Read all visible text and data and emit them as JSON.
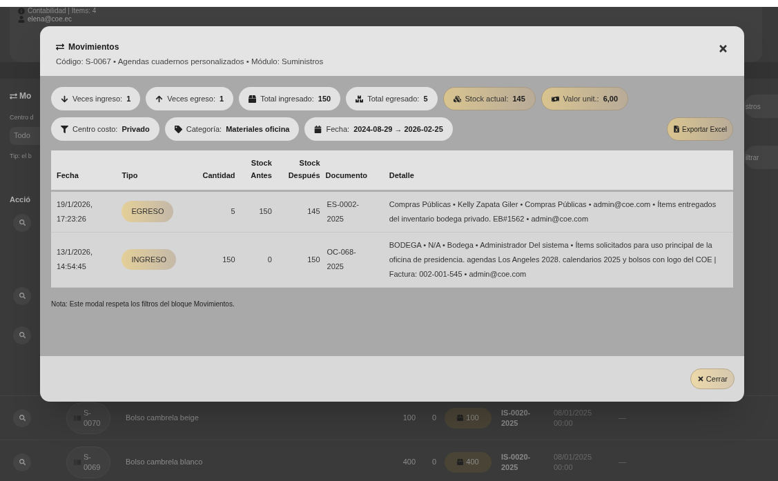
{
  "background": {
    "account": {
      "area": "Contabilidad | Items: 4",
      "email": "elena@coe.ec"
    },
    "section_title": "Mo",
    "filter_label": "Centro d",
    "filter_value": "Todo",
    "tip": "Tip: el b",
    "column_1": "Acció",
    "button_1": "stros",
    "button_2": "iltrar",
    "rows": [
      {
        "code": "S-\n0070",
        "name": "Bolso cambrela beige",
        "column_3": "100",
        "column_4": "0",
        "stock": "100",
        "document": "IS-0020-\n2025",
        "date": "08/01/2025\n00:00",
        "detail": "—"
      },
      {
        "code": "S-\n0069",
        "name": "Bolso cambrela blanco",
        "column_3": "400",
        "column_4": "0",
        "stock": "400",
        "document": "IS-0020-\n2025",
        "date": "08/01/2025\n00:00",
        "detail": "—"
      }
    ]
  },
  "modal": {
    "title": "Movimientos",
    "subtitle": "Código: S-0067 • Agendas cuadernos personalizados • Módulo: Suministros",
    "stats": [
      {
        "kind": "plain",
        "label": "Veces ingreso:",
        "value": "1"
      },
      {
        "kind": "plain",
        "label": "Veces egreso:",
        "value": "1"
      },
      {
        "kind": "plain",
        "label": "Total ingresado:",
        "value": "150"
      },
      {
        "kind": "plain",
        "label": "Total egresado:",
        "value": "5"
      },
      {
        "kind": "highlight",
        "label": "Stock actual:",
        "value": "145"
      },
      {
        "kind": "highlight",
        "label": "Valor unit.:",
        "value": "6,00"
      }
    ],
    "filters": [
      {
        "label": "Centro costo:",
        "value": "Privado"
      },
      {
        "label": "Categoría:",
        "value": "Materiales oficina"
      },
      {
        "label": "Fecha:",
        "value": "2024-08-29 → 2026-02-25"
      }
    ],
    "export_button": "Exportar Excel",
    "table": {
      "columns": [
        "Fecha",
        "Tipo",
        "Cantidad",
        "Stock Antes",
        "Stock Después",
        "Documento",
        "Detalle"
      ],
      "rows": [
        {
          "date": "19/1/2026,\n17:23:26",
          "type": "EGRESO",
          "quantity": "5",
          "stock_before": "150",
          "stock_after": "145",
          "document": "ES-0002-\n2025",
          "detail": "Compras Públicas • Kelly Zapata Giler • Compras Públicas • admin@coe.com • Ítems entregados del inventario bodega privado. EB#1562 • admin@coe.com"
        },
        {
          "date": "13/1/2026,\n14:54:45",
          "type": "INGRESO",
          "quantity": "150",
          "stock_before": "0",
          "stock_after": "150",
          "document": "OC-068-\n2025",
          "detail": "BODEGA • N/A • Bodega • Administrador Del sistema • Ítems solicitados para uso principal de la oficina de presidencia. agendas Los Angeles 2028. calendarios 2025 y bolsos con logo del COE | Factura: 002-001-545 • admin@coe.com"
        }
      ]
    },
    "note": "Nota: Este modal respeta los filtros del bloque Movimientos.",
    "close_button": "Cerrar"
  }
}
